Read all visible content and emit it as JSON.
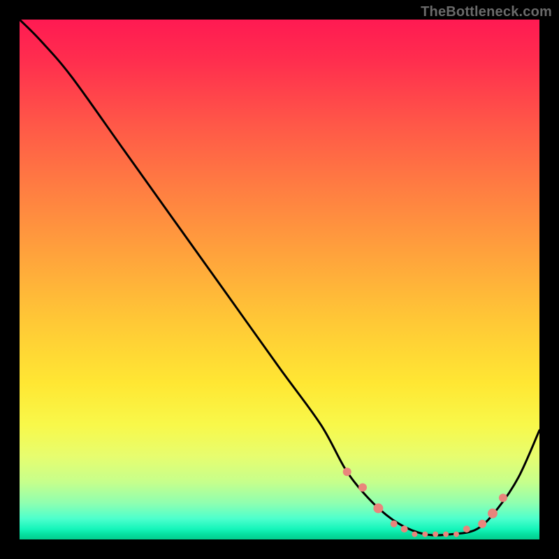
{
  "watermark": "TheBottleneck.com",
  "chart_data": {
    "type": "line",
    "title": "",
    "xlabel": "",
    "ylabel": "",
    "xlim": [
      0,
      100
    ],
    "ylim": [
      0,
      100
    ],
    "series": [
      {
        "name": "bottleneck-curve",
        "x": [
          0,
          4,
          10,
          20,
          30,
          40,
          50,
          58,
          63,
          68,
          73,
          78,
          83,
          88,
          92,
          96,
          100
        ],
        "y": [
          100,
          96,
          89,
          75,
          61,
          47,
          33,
          22,
          13,
          7,
          3,
          1,
          1,
          2,
          6,
          12,
          21
        ]
      }
    ],
    "markers": {
      "name": "highlighted-points",
      "color": "#e9857c",
      "x": [
        63,
        66,
        69,
        72,
        74,
        76,
        78,
        80,
        82,
        84,
        86,
        89,
        91,
        93
      ],
      "y": [
        13,
        10,
        6,
        3,
        2,
        1,
        1,
        1,
        1,
        1,
        2,
        3,
        5,
        8
      ],
      "r": [
        6,
        6,
        7,
        5,
        5,
        4,
        4,
        4,
        4,
        4,
        5,
        6,
        7,
        6
      ]
    },
    "gradient_stops": [
      {
        "pos": 0.0,
        "color": "#ff1a52"
      },
      {
        "pos": 0.45,
        "color": "#ffa23c"
      },
      {
        "pos": 0.78,
        "color": "#f8f84a"
      },
      {
        "pos": 0.93,
        "color": "#8fffb0"
      },
      {
        "pos": 1.0,
        "color": "#03cc8e"
      }
    ]
  }
}
